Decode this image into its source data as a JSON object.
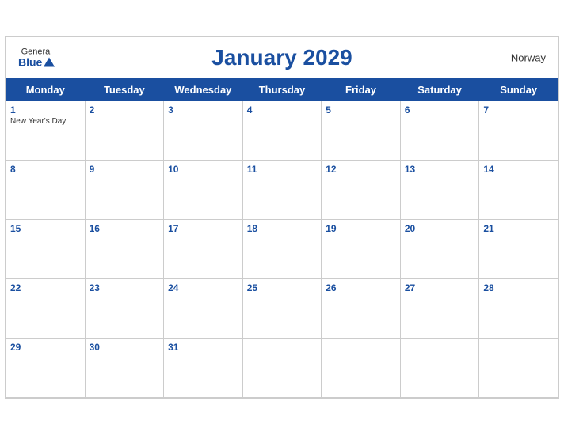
{
  "header": {
    "logo_general": "General",
    "logo_blue": "Blue",
    "title": "January 2029",
    "country": "Norway"
  },
  "weekdays": [
    "Monday",
    "Tuesday",
    "Wednesday",
    "Thursday",
    "Friday",
    "Saturday",
    "Sunday"
  ],
  "weeks": [
    [
      {
        "day": "1",
        "holiday": "New Year's Day"
      },
      {
        "day": "2",
        "holiday": ""
      },
      {
        "day": "3",
        "holiday": ""
      },
      {
        "day": "4",
        "holiday": ""
      },
      {
        "day": "5",
        "holiday": ""
      },
      {
        "day": "6",
        "holiday": ""
      },
      {
        "day": "7",
        "holiday": ""
      }
    ],
    [
      {
        "day": "8",
        "holiday": ""
      },
      {
        "day": "9",
        "holiday": ""
      },
      {
        "day": "10",
        "holiday": ""
      },
      {
        "day": "11",
        "holiday": ""
      },
      {
        "day": "12",
        "holiday": ""
      },
      {
        "day": "13",
        "holiday": ""
      },
      {
        "day": "14",
        "holiday": ""
      }
    ],
    [
      {
        "day": "15",
        "holiday": ""
      },
      {
        "day": "16",
        "holiday": ""
      },
      {
        "day": "17",
        "holiday": ""
      },
      {
        "day": "18",
        "holiday": ""
      },
      {
        "day": "19",
        "holiday": ""
      },
      {
        "day": "20",
        "holiday": ""
      },
      {
        "day": "21",
        "holiday": ""
      }
    ],
    [
      {
        "day": "22",
        "holiday": ""
      },
      {
        "day": "23",
        "holiday": ""
      },
      {
        "day": "24",
        "holiday": ""
      },
      {
        "day": "25",
        "holiday": ""
      },
      {
        "day": "26",
        "holiday": ""
      },
      {
        "day": "27",
        "holiday": ""
      },
      {
        "day": "28",
        "holiday": ""
      }
    ],
    [
      {
        "day": "29",
        "holiday": ""
      },
      {
        "day": "30",
        "holiday": ""
      },
      {
        "day": "31",
        "holiday": ""
      },
      {
        "day": "",
        "holiday": ""
      },
      {
        "day": "",
        "holiday": ""
      },
      {
        "day": "",
        "holiday": ""
      },
      {
        "day": "",
        "holiday": ""
      }
    ]
  ],
  "colors": {
    "header_bg": "#1a4fa0",
    "header_text": "#ffffff",
    "title_color": "#1a4fa0"
  }
}
